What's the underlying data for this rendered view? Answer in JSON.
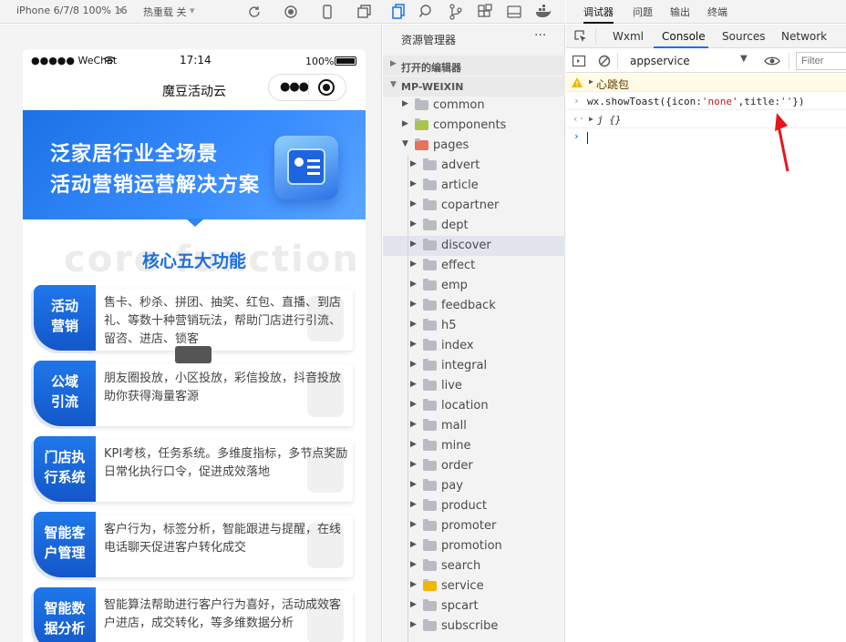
{
  "toolbar": {
    "device": "iPhone 6/7/8 100% 16",
    "hot_reload": "热重载 关"
  },
  "phone": {
    "carrier": "●●●●● WeChat",
    "time": "17:14",
    "battery": "100%",
    "nav_title": "魔豆活动云",
    "banner_line1": "泛家居行业全场景",
    "banner_line2": "活动营销运营解决方案",
    "watermark": "core function",
    "section_title": "核心五大功能",
    "cards": [
      {
        "tag1": "活动",
        "tag2": "营销",
        "desc": "售卡、秒杀、拼团、抽奖、红包、直播、到店礼、等数十种营销玩法，帮助门店进行引流、留咨、进店、锁客"
      },
      {
        "tag1": "公域",
        "tag2": "引流",
        "desc": "朋友圈投放，小区投放，彩信投放，抖音投放助你获得海量客源"
      },
      {
        "tag1": "门店执",
        "tag2": "行系统",
        "desc": "KPI考核，任务系统。多维度指标，多节点奖励日常化执行口令，促进成效落地"
      },
      {
        "tag1": "智能客",
        "tag2": "户管理",
        "desc": "客户行为，标签分析，智能跟进与提醒，在线电话聊天促进客户转化成交"
      },
      {
        "tag1": "智能数",
        "tag2": "据分析",
        "desc": "智能算法帮助进行客户行为喜好，活动成效客户进店，成交转化，等多维数据分析"
      }
    ]
  },
  "explorer": {
    "title": "资源管理器",
    "open_editors": "打开的编辑器",
    "project": "MP-WEIXIN",
    "top_items": [
      "common",
      "components",
      "pages"
    ],
    "pages_children": [
      "advert",
      "article",
      "copartner",
      "dept",
      "discover",
      "effect",
      "emp",
      "feedback",
      "h5",
      "index",
      "integral",
      "live",
      "location",
      "mall",
      "mine",
      "order",
      "pay",
      "product",
      "promoter",
      "promotion",
      "search",
      "service",
      "spcart",
      "subscribe"
    ],
    "selected": "discover"
  },
  "devtools": {
    "top_tabs": [
      "调试器",
      "问题",
      "输出",
      "终端"
    ],
    "panel_tabs": [
      "Wxml",
      "Console",
      "Sources",
      "Network"
    ],
    "active_panel": "Console",
    "context": "appservice",
    "filter_placeholder": "Filter",
    "warning": "心跳包",
    "command_prefix": "wx.showToast({icon:",
    "command_icon": "'none'",
    "command_mid": ",title:",
    "command_title": "''",
    "command_suffix": "})",
    "result": "j {}",
    "colors": {
      "accent": "#1a73e8",
      "warning_bg": "#fffbe5",
      "arrow": "#e8141b"
    }
  }
}
